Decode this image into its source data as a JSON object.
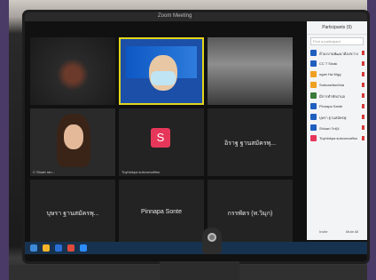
{
  "window": {
    "title": "Zoom Meeting"
  },
  "tiles": [
    {
      "name": "",
      "tag": ""
    },
    {
      "name": "",
      "tag": ""
    },
    {
      "name": "",
      "tag": ""
    },
    {
      "name": "",
      "tag": "C Stuart ran..."
    },
    {
      "name": "",
      "tag": "Tuyhinkpa subconvaffoo",
      "avatar": "S"
    },
    {
      "name": "อิราฐ ฐานสมัครพุ...",
      "tag": ""
    },
    {
      "name": "บุษรา ฐานสมัครพุ...",
      "tag": ""
    },
    {
      "name": "Pinnapa Sonte",
      "tag": ""
    },
    {
      "name": "กรรพัตร (ท.วิมุก)",
      "tag": ""
    }
  ],
  "panel": {
    "title": "Participants (9)",
    "search_placeholder": "Find a participant",
    "participants": [
      {
        "name": "ห้าแรงานพัฒนาต้องขวางสุณชันท์ (Ho",
        "color": "#1f5fbf"
      },
      {
        "name": "CC T Sinak",
        "color": "#1f5fbf"
      },
      {
        "name": "ngan Ha Wgg",
        "color": "#f0a020"
      },
      {
        "name": "Subnashkw2sia",
        "color": "#f0a020"
      },
      {
        "name": "มีการทำทักผ่าน5",
        "color": "#3a7a3a"
      },
      {
        "name": "Pinnapa Sante",
        "color": "#1f5fbf"
      },
      {
        "name": "บุษรา ฐานสมัครพุ",
        "color": "#1f5fbf"
      },
      {
        "name": "Shiuari ระดุง",
        "color": "#1f5fbf"
      },
      {
        "name": "Tuyhinkpa subconvaffoo",
        "color": "#e6375a"
      }
    ],
    "invite_label": "Invite",
    "mute_label": "Mute All"
  },
  "taskbar": {
    "icons": [
      {
        "name": "start-icon",
        "color": "#3d8ad8"
      },
      {
        "name": "explorer-icon",
        "color": "#f5b428"
      },
      {
        "name": "browser-icon",
        "color": "#2a6fd6"
      },
      {
        "name": "chrome-icon",
        "color": "#e04a3a"
      },
      {
        "name": "zoom-icon",
        "color": "#2d8cff"
      }
    ]
  }
}
